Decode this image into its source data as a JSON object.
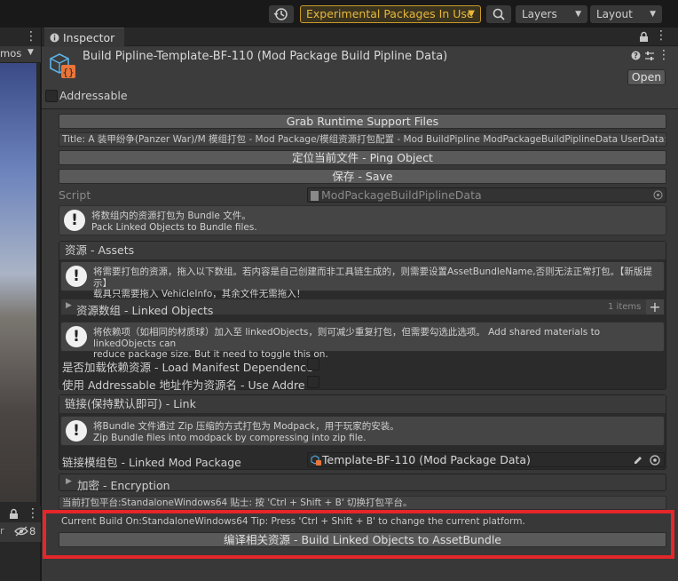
{
  "toolbar": {
    "experimental_label": "Experimental Packages In Use",
    "layers_label": "Layers",
    "layout_label": "Layout"
  },
  "left_panel": {
    "tab_partial": "mos",
    "badge_count": "8"
  },
  "inspector": {
    "tab_label": "Inspector",
    "asset_title": "Build Pipline-Template-BF-110 (Mod Package Build Pipline Data)",
    "open_label": "Open",
    "addressable_label": "Addressable",
    "grab_label": "Grab Runtime Support Files",
    "title_line": "Title: A 装甲纷争(Panzer War)/M 模组打包 - Mod Package/模组资源打包配置 - Mod BuildPipline ModPackageBuildPiplineData UserData:",
    "ping_label": "定位当前文件 - Ping Object",
    "save_label": "保存 - Save",
    "script_label": "Script",
    "script_value": "ModPackageBuildPiplineData",
    "help_main": [
      "将数组内的资源打包为 Bundle 文件。",
      "Pack Linked Objects to Bundle files."
    ],
    "assets_section": {
      "header": "资源 - Assets",
      "help": [
        "将需要打包的资源，拖入以下数组。若内容是自己创建而非工具链生成的，则需要设置AssetBundleName,否则无法正常打包。【新版提示】",
        "载具只需要拖入 VehicleInfo，其余文件无需拖入！"
      ],
      "linked_objects_label": "资源数组 - Linked Objects",
      "items_count": "1 items",
      "help2": [
        "将依赖项（如相同的材质球）加入至 linkedObjects，则可减少重复打包，但需要勾选此选项。 Add shared materials to linkedObjects can",
        "reduce package size. But it need to toggle this on."
      ],
      "load_manifest_label": "是否加载依赖资源 - Load Manifest Dependence",
      "use_addressable_label": "使用 Addressable 地址作为资源名 - Use Addressal"
    },
    "link_section": {
      "header": "链接(保持默认即可) - Link",
      "help": [
        "将Bundle 文件通过 Zip 压缩的方式打包为 Modpack，用于玩家的安装。",
        "Zip Bundle files into modpack by compressing into zip file."
      ],
      "linked_mod_label": "链接模组包 - Linked Mod Package",
      "linked_mod_value": "Template-BF-110 (Mod Package Data)"
    },
    "encryption_label": "加密 - Encryption",
    "platform_cn": "当前打包平台:StandaloneWindows64   贴士: 按 'Ctrl + Shift + B' 切换打包平台。",
    "platform_en": "Current Build On:StandaloneWindows64   Tip: Press 'Ctrl + Shift + B' to change the current platform.",
    "build_label": "编译相关资源 - Build Linked Objects to AssetBundle"
  },
  "colors": {
    "highlight": "#e5262a",
    "experimental": "#e8b83a"
  }
}
